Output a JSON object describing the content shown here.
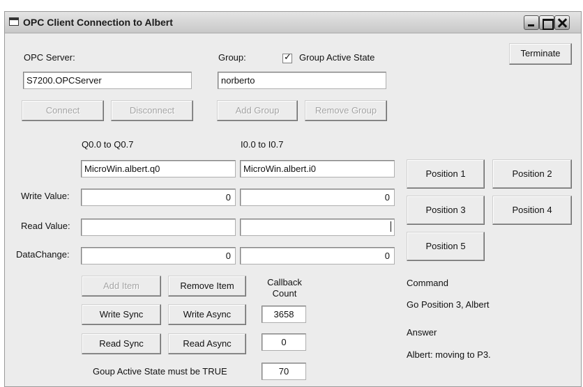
{
  "window": {
    "title": "OPC Client Connection to Albert"
  },
  "server": {
    "label": "OPC Server:",
    "value": "S7200.OPCServer"
  },
  "group": {
    "label": "Group:",
    "value": "norberto",
    "active_state_label": "Group Active State",
    "active_state_checked": true
  },
  "buttons": {
    "terminate": "Terminate",
    "connect": "Connect",
    "disconnect": "Disconnect",
    "add_group": "Add Group",
    "remove_group": "Remove Group",
    "add_item": "Add Item",
    "remove_item": "Remove Item",
    "write_sync": "Write Sync",
    "write_async": "Write Async",
    "read_sync": "Read Sync",
    "read_async": "Read Async"
  },
  "outputs": {
    "header": "Q0.0 to Q0.7",
    "item": "MicroWin.albert.q0",
    "write_value": "0",
    "read_value": "",
    "data_change": "0"
  },
  "inputs": {
    "header": "I0.0 to I0.7",
    "item": "MicroWin.albert.i0",
    "write_value": "0",
    "read_value": "",
    "data_change": "0"
  },
  "row_labels": {
    "write_value": "Write Value:",
    "read_value": "Read Value:",
    "data_change": "DataChange:"
  },
  "callback": {
    "label_line1": "Callback",
    "label_line2": "Count",
    "count": "3658",
    "box2": "0",
    "box3": "70"
  },
  "status_note": "Goup Active State must be TRUE",
  "positions": [
    "Position 1",
    "Position 2",
    "Position 3",
    "Position 4",
    "Position 5"
  ],
  "command": {
    "label": "Command",
    "value": "Go Position 3, Albert"
  },
  "answer": {
    "label": "Answer",
    "value": "Albert: moving to P3."
  }
}
